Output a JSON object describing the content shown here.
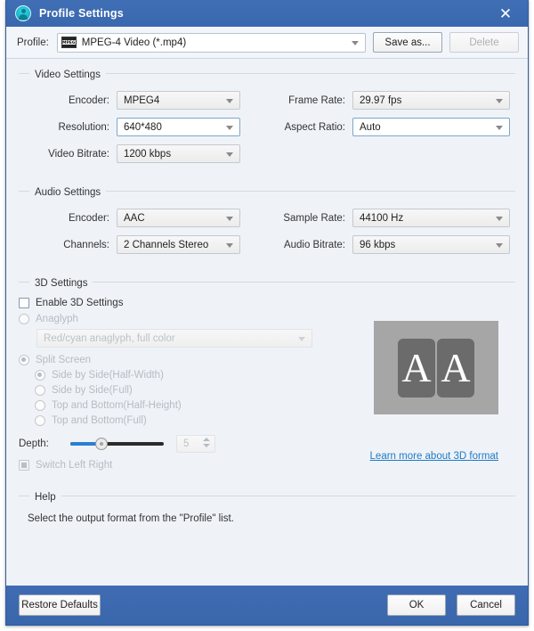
{
  "window": {
    "title": "Profile Settings",
    "title_icon": "user-circle-icon",
    "close_icon": "close-icon",
    "accent_color": "#3a68ae",
    "background_color": "#eff3f8"
  },
  "profile_row": {
    "label": "Profile:",
    "format_icon": "mpeg-film-icon",
    "icon_text": "MPEG",
    "value": "MPEG-4 Video (*.mp4)",
    "save_as_label": "Save as...",
    "delete_label": "Delete",
    "delete_disabled": true
  },
  "video_settings": {
    "title": "Video Settings",
    "fields": [
      {
        "label": "Encoder:",
        "value": "MPEG4",
        "style": "gray"
      },
      {
        "label": "Resolution:",
        "value": "640*480",
        "style": "white"
      },
      {
        "label": "Video Bitrate:",
        "value": "1200 kbps",
        "style": "gray"
      },
      {
        "label": "Frame Rate:",
        "value": "29.97 fps",
        "style": "gray"
      },
      {
        "label": "Aspect Ratio:",
        "value": "Auto",
        "style": "white"
      }
    ]
  },
  "audio_settings": {
    "title": "Audio Settings",
    "fields": [
      {
        "label": "Encoder:",
        "value": "AAC",
        "style": "gray"
      },
      {
        "label": "Channels:",
        "value": "2 Channels Stereo",
        "style": "gray"
      },
      {
        "label": "Sample Rate:",
        "value": "44100 Hz",
        "style": "gray"
      },
      {
        "label": "Audio Bitrate:",
        "value": "96 kbps",
        "style": "gray"
      }
    ]
  },
  "three_d_settings": {
    "title": "3D Settings",
    "enable_label": "Enable 3D Settings",
    "enable_checked": false,
    "anaglyph_label": "Anaglyph",
    "anaglyph_selected": false,
    "anaglyph_mode": "Red/cyan anaglyph, full color",
    "split_screen_label": "Split Screen",
    "split_screen_selected": true,
    "split_options": [
      {
        "label": "Side by Side(Half-Width)",
        "selected": true
      },
      {
        "label": "Side by Side(Full)",
        "selected": false
      },
      {
        "label": "Top and Bottom(Half-Height)",
        "selected": false
      },
      {
        "label": "Top and Bottom(Full)",
        "selected": false
      }
    ],
    "depth_label": "Depth:",
    "depth_value": "5",
    "switch_lr_label": "Switch Left Right",
    "switch_lr_checked": true,
    "preview_left_letter": "A",
    "preview_right_letter": "A",
    "learn_link": "Learn more about 3D format",
    "link_color": "#1f7ac4"
  },
  "help": {
    "title": "Help",
    "text": "Select the output format from the \"Profile\" list."
  },
  "footer": {
    "restore_label": "Restore Defaults",
    "ok_label": "OK",
    "cancel_label": "Cancel"
  }
}
